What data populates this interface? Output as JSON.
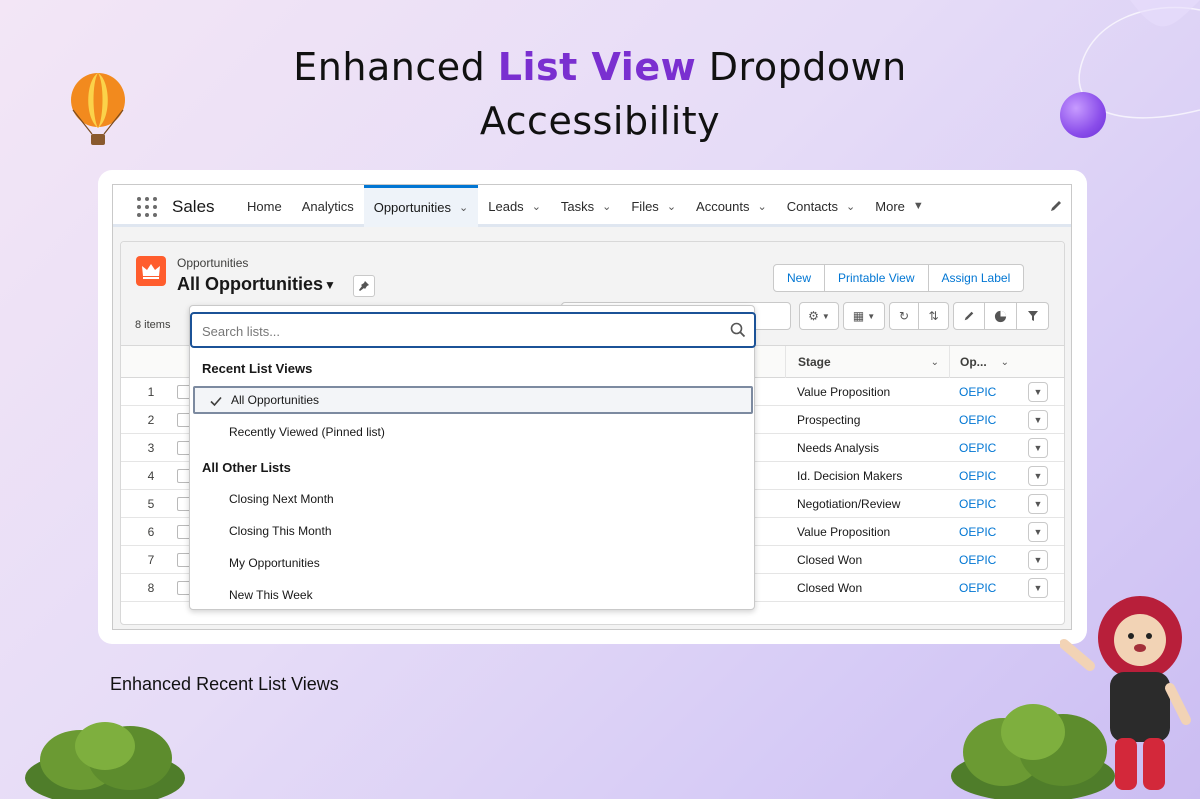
{
  "headline": {
    "part1": "Enhanced ",
    "accent": "List View",
    "part2": " Dropdown",
    "line2": "Accessibility"
  },
  "subcaption": "Enhanced Recent List Views",
  "colors": {
    "accent": "#7a2fd0",
    "link": "#0176d3",
    "object_icon": "#ff5d2d"
  },
  "nav": {
    "app_name": "Sales",
    "tabs": [
      {
        "label": "Home",
        "has_menu": false
      },
      {
        "label": "Analytics",
        "has_menu": false
      },
      {
        "label": "Opportunities",
        "has_menu": true,
        "active": true
      },
      {
        "label": "Leads",
        "has_menu": true
      },
      {
        "label": "Tasks",
        "has_menu": true
      },
      {
        "label": "Files",
        "has_menu": true
      },
      {
        "label": "Accounts",
        "has_menu": true
      },
      {
        "label": "Contacts",
        "has_menu": true
      },
      {
        "label": "More",
        "has_menu": true
      }
    ]
  },
  "list_header": {
    "object_label": "Opportunities",
    "view_name": "All Opportunities",
    "buttons": [
      "New",
      "Printable View",
      "Assign Label"
    ],
    "items_count": "8 items"
  },
  "table": {
    "columns": {
      "stage": "Stage",
      "opp": "Op..."
    },
    "rows": [
      {
        "num": "1",
        "stage": "Value Proposition",
        "opp": "OEPIC"
      },
      {
        "num": "2",
        "stage": "Prospecting",
        "opp": "OEPIC"
      },
      {
        "num": "3",
        "stage": "Needs Analysis",
        "opp": "OEPIC"
      },
      {
        "num": "4",
        "stage": "Id. Decision Makers",
        "opp": "OEPIC"
      },
      {
        "num": "5",
        "stage": "Negotiation/Review",
        "opp": "OEPIC"
      },
      {
        "num": "6",
        "stage": "Value Proposition",
        "opp": "OEPIC"
      },
      {
        "num": "7",
        "stage": "Closed Won",
        "opp": "OEPIC"
      },
      {
        "num": "8",
        "stage": "Closed Won",
        "opp": "OEPIC"
      }
    ]
  },
  "dropdown": {
    "search_placeholder": "Search lists...",
    "recent_title": "Recent List Views",
    "recent_items": [
      "All Opportunities",
      "Recently Viewed (Pinned list)"
    ],
    "selected_item": "All Opportunities",
    "other_title": "All Other Lists",
    "other_items": [
      "Closing Next Month",
      "Closing This Month",
      "My Opportunities",
      "New This Week"
    ]
  }
}
